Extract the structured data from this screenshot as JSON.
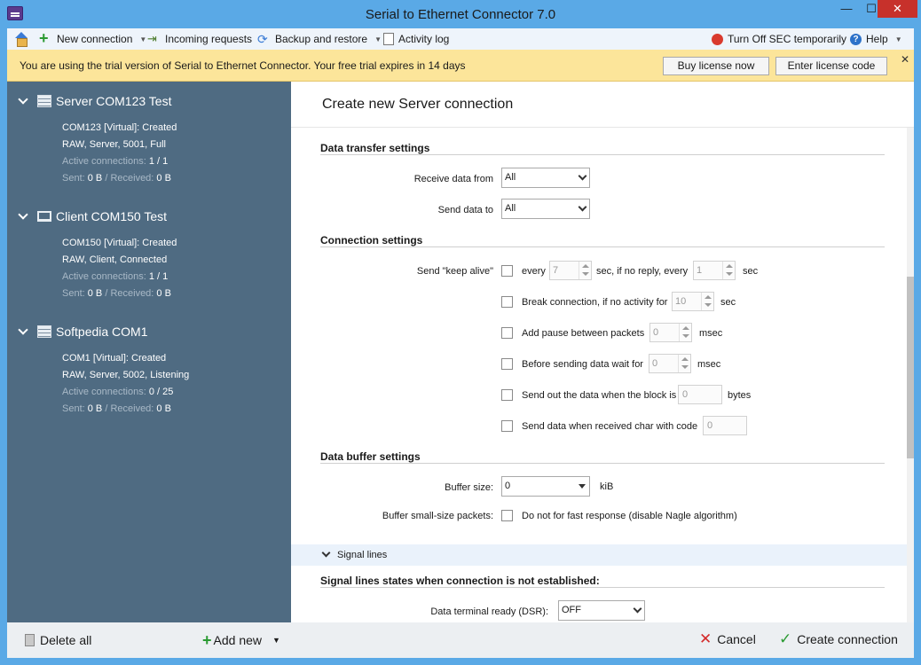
{
  "window": {
    "title": "Serial to Ethernet Connector 7.0",
    "minimize": "—",
    "maximize": "☐",
    "close": "✕"
  },
  "toolbar": {
    "new_connection": "New connection",
    "incoming_requests": "Incoming requests",
    "backup_restore": "Backup and restore",
    "activity_log": "Activity log",
    "turn_off_sec": "Turn Off SEC temporarily",
    "help": "Help"
  },
  "banner": {
    "text": "You are using the trial version of Serial to Ethernet Connector. Your free trial expires in 14 days",
    "buy": "Buy license now",
    "enter": "Enter license code",
    "close": "✕"
  },
  "connections": [
    {
      "name": "Server COM123 Test",
      "line1": "COM123 [Virtual]: Created",
      "line2": "RAW, Server, 5001, Full",
      "active_label": "Active connections:",
      "active_value": "1 / 1",
      "sent_label": "Sent:",
      "sent_value": "0 B",
      "recv_label": "/ Received:",
      "recv_value": "0 B"
    },
    {
      "name": "Client COM150 Test",
      "line1": "COM150 [Virtual]: Created",
      "line2": "RAW, Client, Connected",
      "active_label": "Active connections:",
      "active_value": "1 / 1",
      "sent_label": "Sent:",
      "sent_value": "0 B",
      "recv_label": "/ Received:",
      "recv_value": "0 B"
    },
    {
      "name": "Softpedia COM1",
      "line1": "COM1 [Virtual]: Created",
      "line2": "RAW, Server, 5002, Listening",
      "active_label": "Active connections:",
      "active_value": "0 / 25",
      "sent_label": "Sent:",
      "sent_value": "0 B",
      "recv_label": "/ Received:",
      "recv_value": "0 B"
    }
  ],
  "left_footer": {
    "delete_all": "Delete all",
    "add_new": "Add new"
  },
  "form": {
    "title": "Create new Server connection",
    "data_transfer": {
      "heading": "Data transfer settings",
      "receive_label": "Receive data from",
      "receive_value": "All",
      "send_label": "Send data to",
      "send_value": "All"
    },
    "connection": {
      "heading": "Connection settings",
      "keep_alive_label": "Send \"keep alive\"",
      "every": "every",
      "every_value": "7",
      "if_no_reply": "sec, if no reply, every",
      "reply_value": "1",
      "sec": "sec",
      "break_label": "Break connection, if no activity for",
      "break_value": "10",
      "break_unit": "sec",
      "pause_label": "Add pause between packets",
      "pause_value": "0",
      "pause_unit": "msec",
      "wait_label": "Before sending data wait for",
      "wait_value": "0",
      "wait_unit": "msec",
      "block_label": "Send out the data when the block is",
      "block_value": "0",
      "block_unit": "bytes",
      "char_label": "Send data when received char with code",
      "char_value": "0"
    },
    "buffer": {
      "heading": "Data buffer settings",
      "size_label": "Buffer size:",
      "size_value": "0",
      "size_unit": "kiB",
      "small_label": "Buffer small-size packets:",
      "small_text": "Do not for fast response (disable Nagle algorithm)"
    },
    "signal": {
      "toggle": "Signal lines",
      "heading": "Signal lines states when connection is not established:",
      "dtr_label": "Data terminal ready (DSR):",
      "dtr_value": "OFF"
    }
  },
  "right_footer": {
    "cancel": "Cancel",
    "create": "Create connection"
  }
}
